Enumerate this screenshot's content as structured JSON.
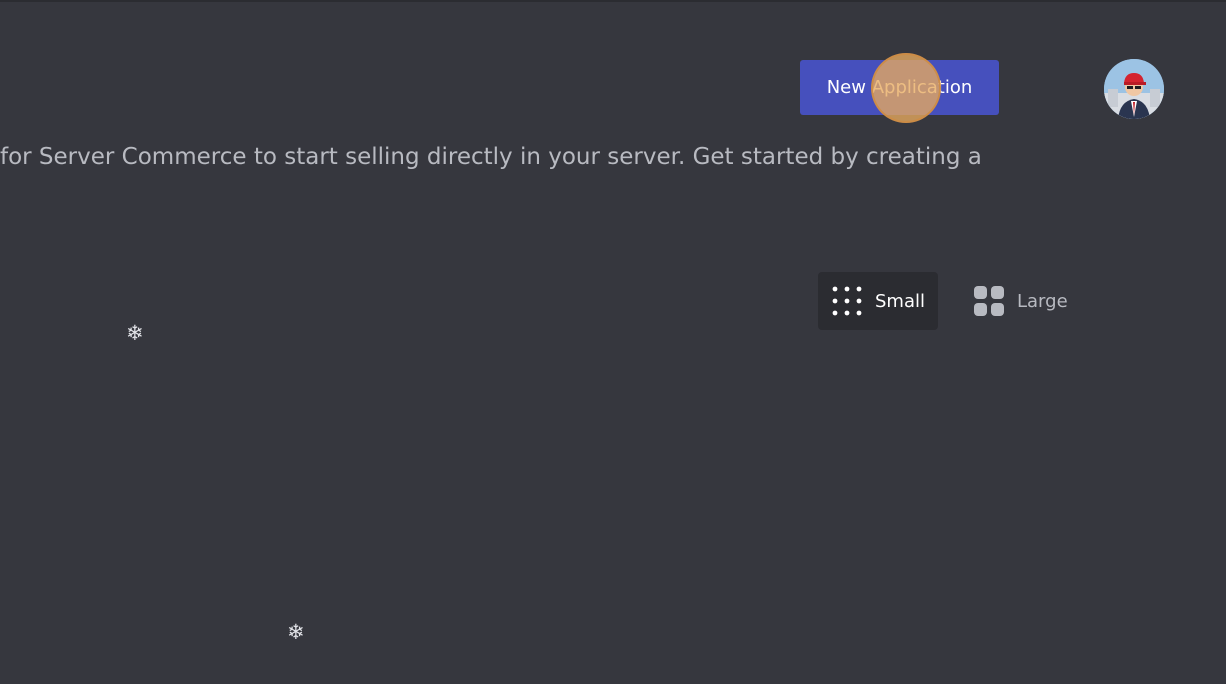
{
  "header": {
    "new_application_label": "New Application"
  },
  "main": {
    "description_text": "for Server Commerce to start selling directly in your server. Get started by creating a"
  },
  "view_toggle": {
    "small_label": "Small",
    "large_label": "Large",
    "selected": "Small"
  },
  "decorations": {
    "snowflake_glyph": "❄"
  },
  "colors": {
    "background": "#36373e",
    "primary_button": "#4650bd",
    "toggle_selected_bg": "#2b2c31",
    "muted_text": "#b8bac1",
    "click_indicator": "#e8aa5f"
  },
  "icons": {
    "small_view": "grid-small-icon",
    "large_view": "grid-large-icon",
    "avatar": "user-avatar"
  }
}
